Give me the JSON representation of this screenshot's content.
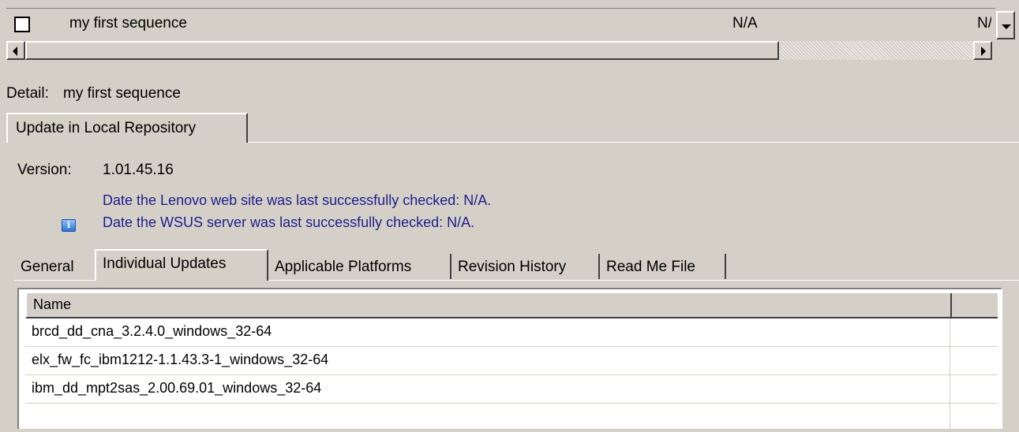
{
  "sequence_table": {
    "rows": [
      {
        "checked": false,
        "name": "my first sequence",
        "col2": "N/A",
        "col3": "N/A"
      }
    ]
  },
  "detail": {
    "label": "Detail:",
    "value": "my first sequence"
  },
  "top_tabs": [
    {
      "label": "Update in Local Repository",
      "selected": true
    }
  ],
  "version": {
    "label": "Version:",
    "value": "1.01.45.16"
  },
  "messages": [
    "Date the Lenovo web site was last successfully checked: N/A.",
    "Date the WSUS server was last successfully checked: N/A."
  ],
  "info_icon": "info-icon",
  "detail_tabs": [
    {
      "label": "General",
      "selected": false
    },
    {
      "label": "Individual Updates",
      "selected": true
    },
    {
      "label": "Applicable Platforms",
      "selected": false
    },
    {
      "label": "Revision History",
      "selected": false
    },
    {
      "label": "Read Me File",
      "selected": false
    }
  ],
  "updates_table": {
    "columns": [
      "Name",
      ""
    ],
    "rows": [
      "brcd_dd_cna_3.2.4.0_windows_32-64",
      "elx_fw_fc_ibm1212-1.1.43.3-1_windows_32-64",
      "ibm_dd_mpt2sas_2.00.69.01_windows_32-64"
    ]
  },
  "colors": {
    "background": "#d4d0c8",
    "message_text": "#1e1e8c",
    "table_background": "#ffffff"
  }
}
